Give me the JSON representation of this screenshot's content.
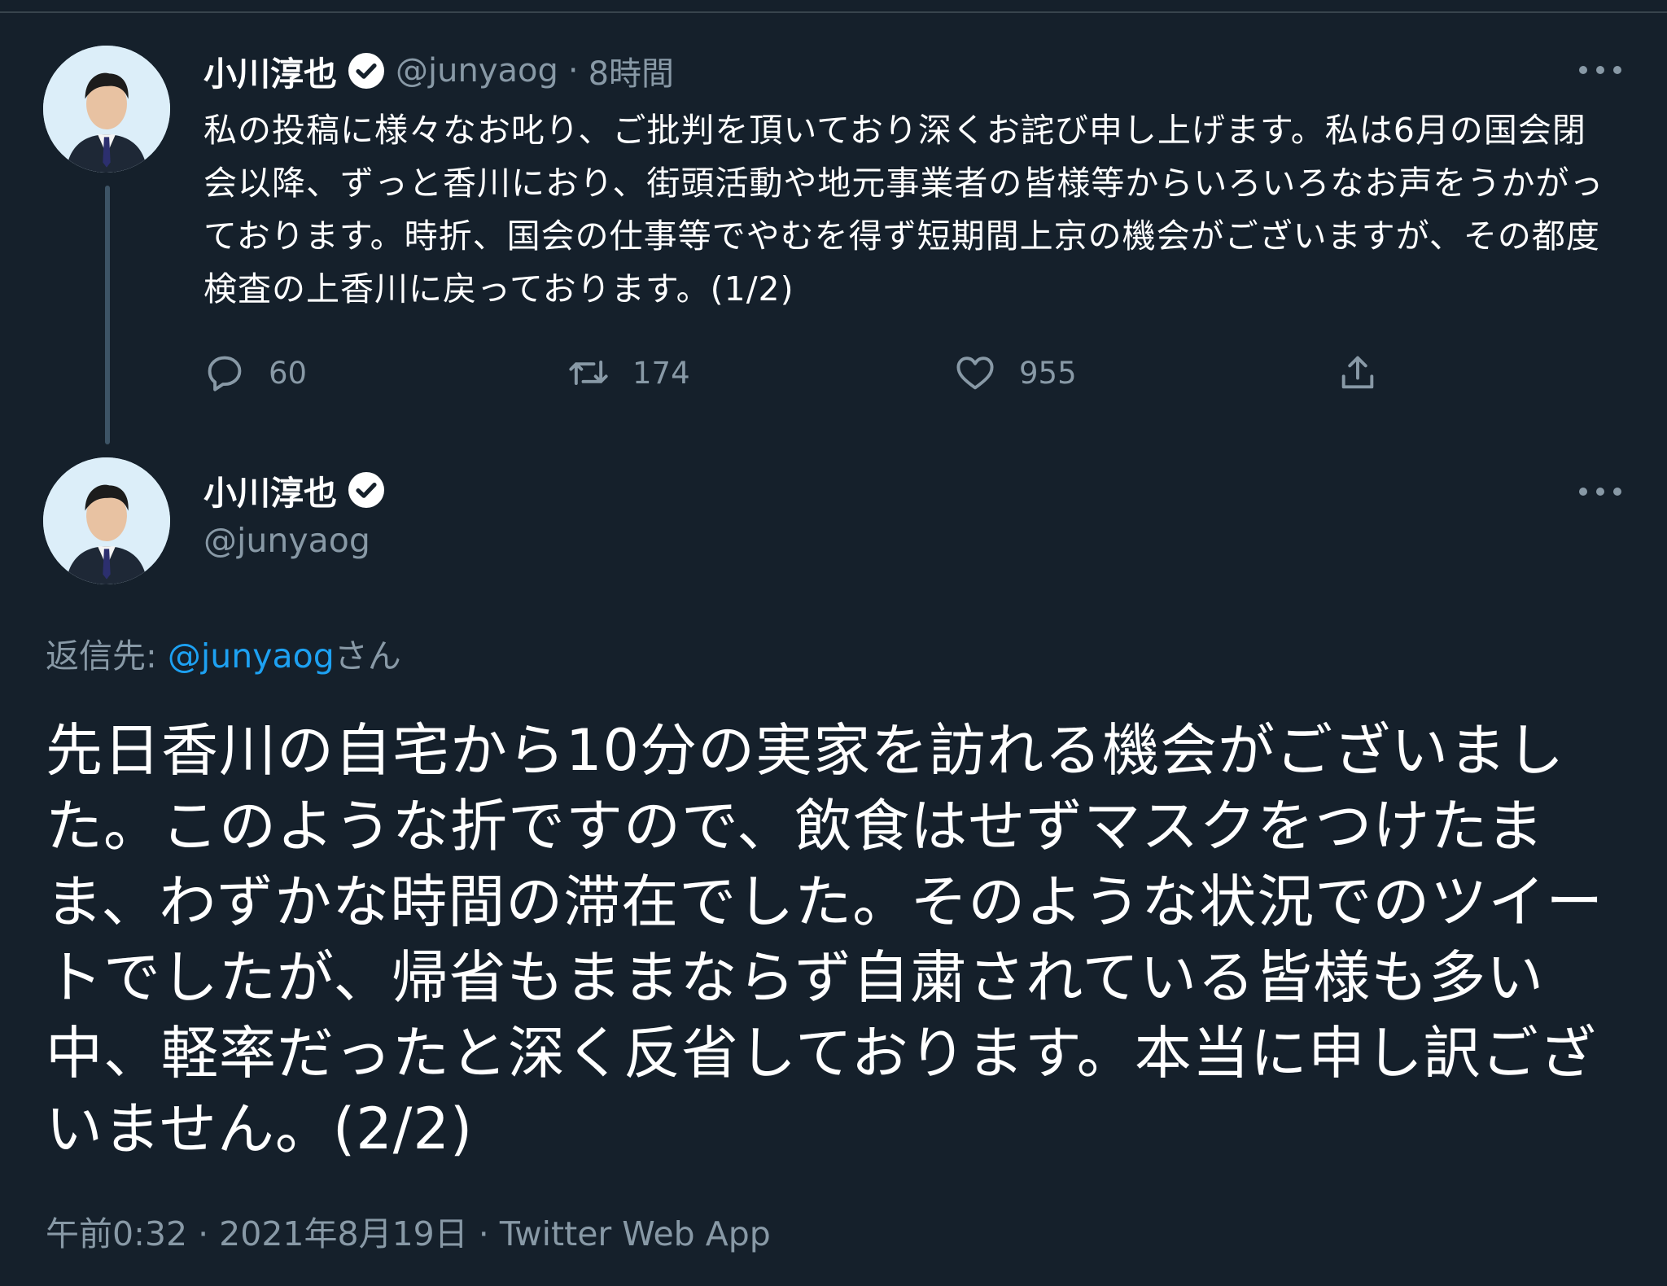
{
  "tweet1": {
    "name": "小川淳也",
    "handle": "@junyaog",
    "separator": "·",
    "time": "8時間",
    "text": "私の投稿に様々なお叱り、ご批判を頂いており深くお詫び申し上げます。私は6月の国会閉会以降、ずっと香川におり、街頭活動や地元事業者の皆様等からいろいろなお声をうかがっております。時折、国会の仕事等でやむを得ず短期間上京の機会がございますが、その都度検査の上香川に戻っております。(1/2)",
    "replies": "60",
    "retweets": "174",
    "likes": "955"
  },
  "tweet2": {
    "name": "小川淳也",
    "handle": "@junyaog",
    "reply_label": "返信先: ",
    "reply_handle": "@junyaog",
    "reply_suffix": "さん",
    "text": "先日香川の自宅から10分の実家を訪れる機会がございました。このような折ですので、飲食はせずマスクをつけたまま、わずかな時間の滞在でした。そのような状況でのツイートでしたが、帰省もままならず自粛されている皆様も多い中、軽率だったと深く反省しております。本当に申し訳ございません。(2/2)",
    "timestamp": "午前0:32 · 2021年8月19日 · Twitter Web App"
  },
  "icons": {
    "reply": "speech-bubble-icon",
    "retweet": "retweet-arrows-icon",
    "like": "heart-icon",
    "share": "share-upload-icon",
    "more": "more-dots-icon",
    "verified": "verified-badge-icon"
  },
  "colors": {
    "background": "#15202b",
    "text_primary": "#ffffff",
    "text_secondary": "#8899a6",
    "link": "#1da1f2",
    "thread_line": "#3d5466"
  }
}
